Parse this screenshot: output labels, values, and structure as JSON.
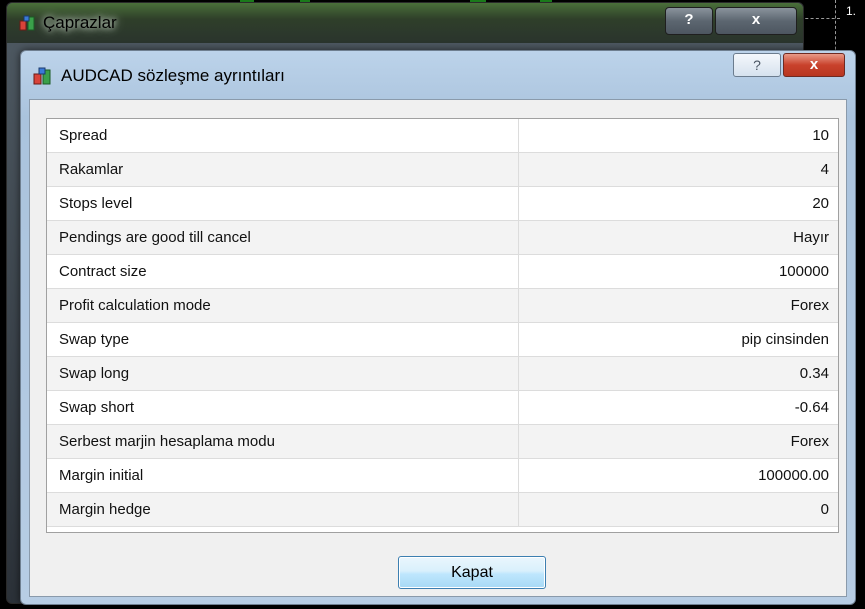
{
  "outer_window": {
    "title": "Çaprazlar",
    "help_label": "?",
    "close_label": "x"
  },
  "background": {
    "edge_label": "1."
  },
  "dialog": {
    "title": "AUDCAD sözleşme ayrıntıları",
    "help_label": "?",
    "close_label": "x",
    "rows": [
      {
        "label": "Spread",
        "value": "10"
      },
      {
        "label": "Rakamlar",
        "value": "4"
      },
      {
        "label": "Stops level",
        "value": "20"
      },
      {
        "label": "Pendings are good till cancel",
        "value": "Hayır"
      },
      {
        "label": "Contract size",
        "value": "100000"
      },
      {
        "label": "Profit calculation mode",
        "value": "Forex"
      },
      {
        "label": "Swap type",
        "value": "pip cinsinden"
      },
      {
        "label": "Swap long",
        "value": "0.34"
      },
      {
        "label": "Swap short",
        "value": "-0.64"
      },
      {
        "label": "Serbest marjin hesaplama modu",
        "value": "Forex"
      },
      {
        "label": "Margin initial",
        "value": "100000.00"
      },
      {
        "label": "Margin hedge",
        "value": "0"
      }
    ],
    "close_button_label": "Kapat"
  },
  "colors": {
    "dialog_close": "#c9422c",
    "button_border": "#3c7fb1",
    "chart_green": "#1a7a1a"
  },
  "icons": {
    "outer_app": "app-icon",
    "dialog_app": "app-icon"
  }
}
